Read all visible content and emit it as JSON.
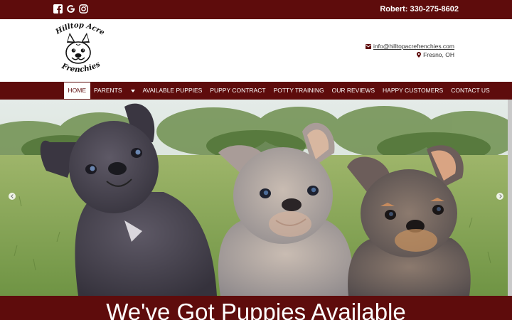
{
  "topbar": {
    "social_icons": [
      "facebook-icon",
      "google-icon",
      "instagram-icon"
    ],
    "phone": "Robert: 330-275-8602"
  },
  "header": {
    "logo_text_top": "Hilltop Acre",
    "logo_text_bottom": "Frenchies",
    "email": "info@hilltopacrefrenchies.com",
    "location": "Fresno, OH"
  },
  "nav": {
    "items": [
      {
        "label": "HOME",
        "active": true
      },
      {
        "label": "PARENTS",
        "dropdown": true
      },
      {
        "label": "AVAILABLE PUPPIES"
      },
      {
        "label": "PUPPY CONTRACT"
      },
      {
        "label": "POTTY TRAINING"
      },
      {
        "label": "OUR REVIEWS"
      },
      {
        "label": "HAPPY CUSTOMERS"
      },
      {
        "label": "CONTACT US"
      }
    ]
  },
  "hero": {
    "banner_text": "We've Got Puppies Available"
  },
  "colors": {
    "brand": "#5e0c0c",
    "text_light": "#ffffff"
  }
}
